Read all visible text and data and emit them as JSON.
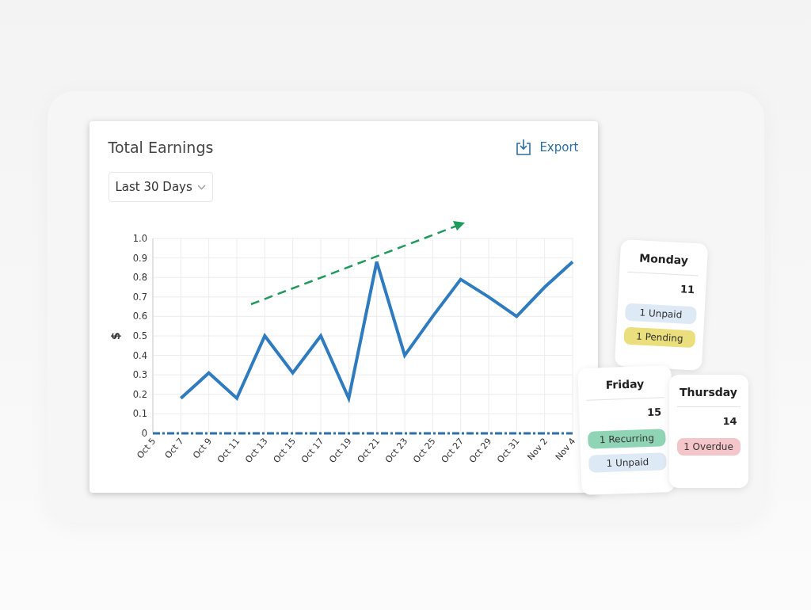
{
  "earnings_card": {
    "title": "Total Earnings",
    "export_label": "Export",
    "period_dropdown": {
      "value": "Last 30 Days"
    },
    "chart_data": {
      "type": "line",
      "grid": true,
      "ylabel": "$",
      "categories": [
        "Oct 5",
        "Oct 7",
        "Oct 9",
        "Oct 11",
        "Oct 13",
        "Oct 15",
        "Oct 17",
        "Oct 19",
        "Oct 21",
        "Oct 23",
        "Oct 25",
        "Oct 27",
        "Oct 29",
        "Oct 31",
        "Nov 2",
        "Nov 4"
      ],
      "ylim": [
        0,
        1
      ],
      "yticks": [
        0,
        0.1,
        0.2,
        0.3,
        0.4,
        0.5,
        0.6,
        0.7,
        0.8,
        0.9,
        {
          "value": 1,
          "label": "1.0"
        }
      ],
      "series": [
        {
          "color": "#2f7bbf",
          "values": [
            null,
            0.18,
            0.31,
            0.18,
            0.5,
            0.31,
            0.5,
            0.18,
            0.88,
            0.4,
            0.6,
            0.79,
            0.7,
            0.6,
            0.75,
            0.88
          ]
        },
        {
          "color": "#2f6fa8",
          "line_style": "dashed",
          "values": [
            0,
            0,
            0,
            0,
            0,
            0,
            0,
            0,
            0,
            0,
            0,
            0,
            0,
            0,
            0,
            0
          ]
        }
      ]
    }
  },
  "day_cards": [
    {
      "day": "Monday",
      "date": "11",
      "tags": [
        {
          "label": "1 Unpaid",
          "color": "#dde9f4"
        },
        {
          "label": "1 Pending",
          "color": "#ebde7c"
        }
      ]
    },
    {
      "day": "Friday",
      "date": "15",
      "tags": [
        {
          "label": "1 Recurring",
          "color": "#90d4b6"
        },
        {
          "label": "1 Unpaid",
          "color": "#dde9f4"
        }
      ]
    },
    {
      "day": "Thursday",
      "date": "14",
      "tags": [
        {
          "label": "1 Overdue",
          "color": "#f4c6c9"
        }
      ]
    }
  ]
}
